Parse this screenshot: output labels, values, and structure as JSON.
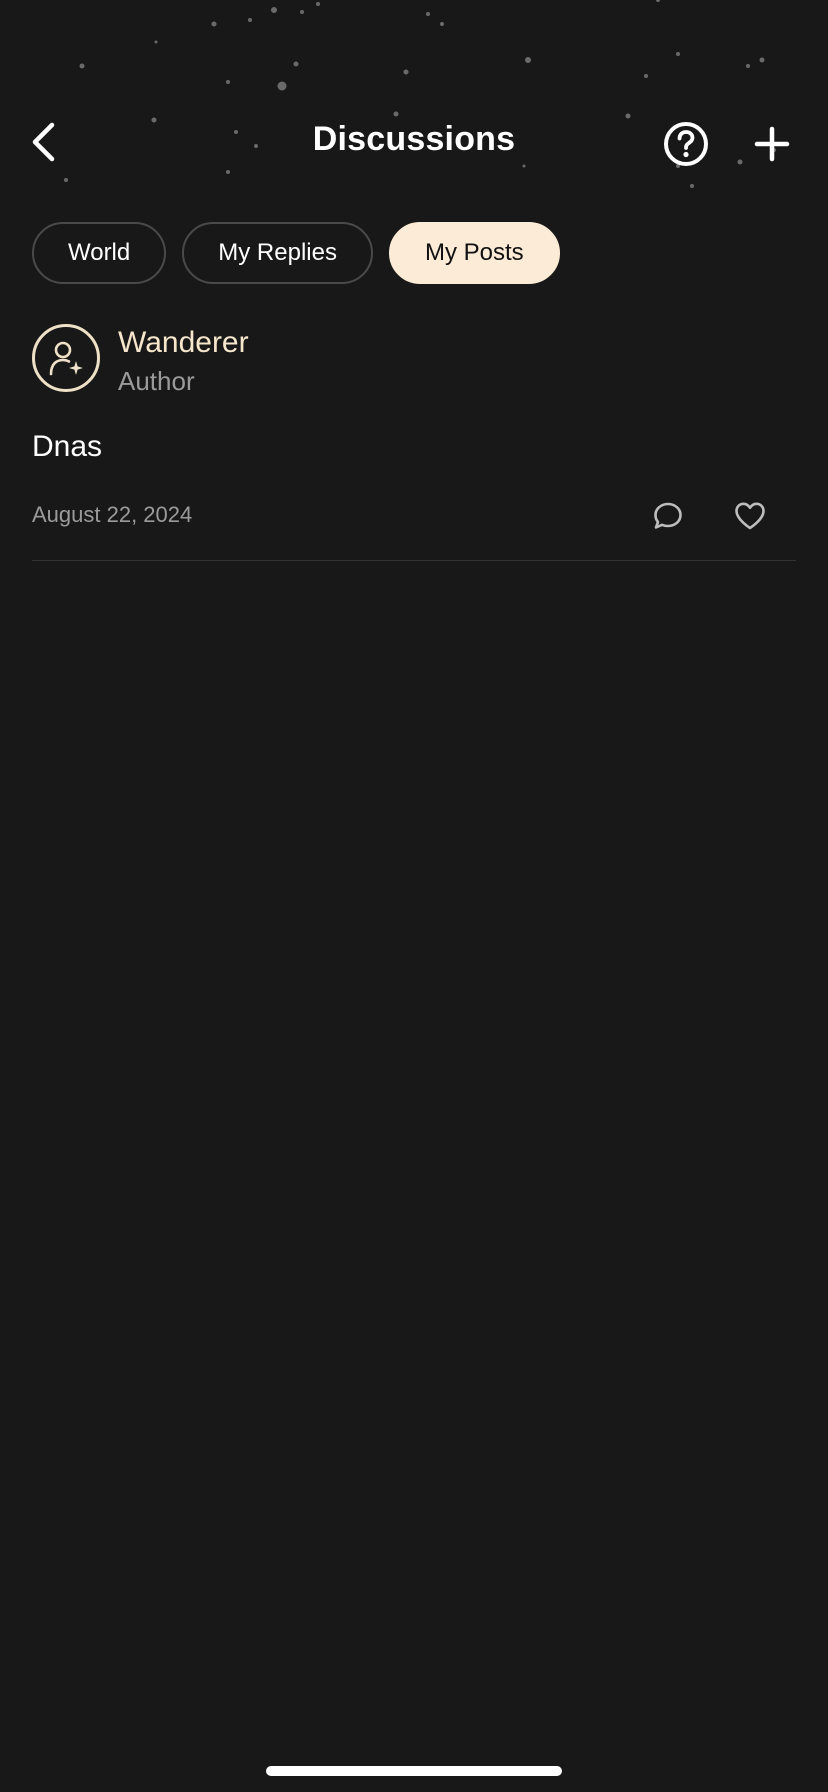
{
  "header": {
    "title": "Discussions",
    "back_icon": "chevron-left-icon",
    "help_icon": "question-circle-icon",
    "add_icon": "plus-icon"
  },
  "tabs": [
    {
      "label": "World",
      "active": false
    },
    {
      "label": "My Replies",
      "active": false
    },
    {
      "label": "My Posts",
      "active": true
    }
  ],
  "posts": [
    {
      "author_name": "Wanderer",
      "author_role": "Author",
      "body": "Dnas",
      "date": "August 22, 2024",
      "avatar_icon": "user-sparkle-icon",
      "comment_icon": "comment-icon",
      "like_icon": "heart-icon"
    }
  ],
  "colors": {
    "background": "#181818",
    "accent": "#fcebd6",
    "author_name": "#f6e6cc",
    "muted_text": "#9b9b9b"
  }
}
